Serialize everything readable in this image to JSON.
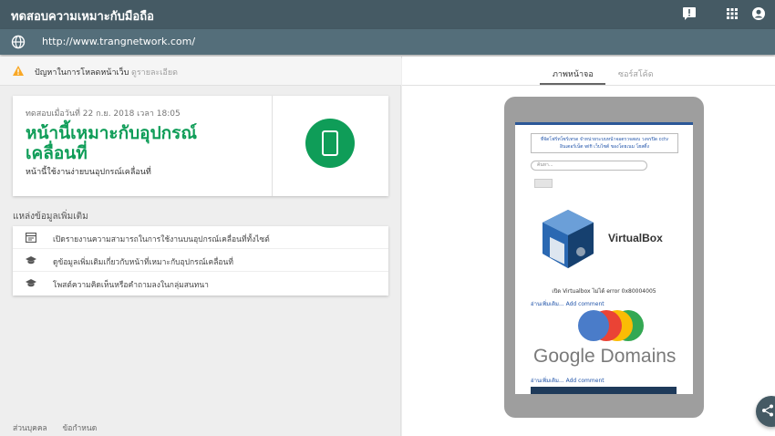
{
  "app": {
    "title": "ทดสอบความเหมาะกับมือถือ",
    "url": "http://www.trangnetwork.com/"
  },
  "warning": {
    "text": "ปัญหาในการโหลดหน้าเว็บ",
    "link": "ดูรายละเอียด"
  },
  "result": {
    "date": "ทดสอบเมื่อวันที่ 22 ก.ย. 2018 เวลา 18:05",
    "headline_line1": "หน้านี้เหมาะกับอุปกรณ์",
    "headline_line2": "เคลื่อนที่",
    "subtext": "หน้านี้ใช้งานง่ายบนอุปกรณ์เคลื่อนที่"
  },
  "resources": {
    "title": "แหล่งข้อมูลเพิ่มเติม",
    "items": [
      {
        "label": "เปิดรายงานความสามารถในการใช้งานบนอุปกรณ์เคลื่อนที่ทั้งไซต์",
        "icon": "report-icon"
      },
      {
        "label": "ดูข้อมูลเพิ่มเติมเกี่ยวกับหน้าที่เหมาะกับอุปกรณ์เคลื่อนที่",
        "icon": "school-icon"
      },
      {
        "label": "โพสต์ความคิดเห็นหรือคำถามลงในกลุ่มสนทนา",
        "icon": "school-icon"
      }
    ]
  },
  "footer": {
    "privacy": "ส่วนบุคคล",
    "terms": "ข้อกำหนด"
  },
  "tabs": {
    "screenshot": "ภาพหน้าจอ",
    "source": "ซอร์สโค้ด"
  },
  "preview": {
    "banner": "ที่จัดโฟร์ทโซร์เทรด จำหน่ายระบบหน้าจอตรวจสอบ วงจรปิด cctv อินเตอร์เน็ต wifi เว็บไซต์ ของโดยเนม โฮสติ้ง",
    "search_placeholder": "ค้นหา...",
    "vbox_text": "VirtualBox",
    "caption": "เปิด Virtualbox ไม่ได้ error 0x80004005",
    "more_link_1": "อ่านเพิ่มเติม... Add comment",
    "google_text": "Google Domains",
    "more_link_2": "อ่านเพิ่มเติม... Add comment"
  },
  "colors": {
    "topbar": "#455a64",
    "urlbar": "#546e7a",
    "success": "#0f9d58",
    "warning": "#f9a825"
  }
}
